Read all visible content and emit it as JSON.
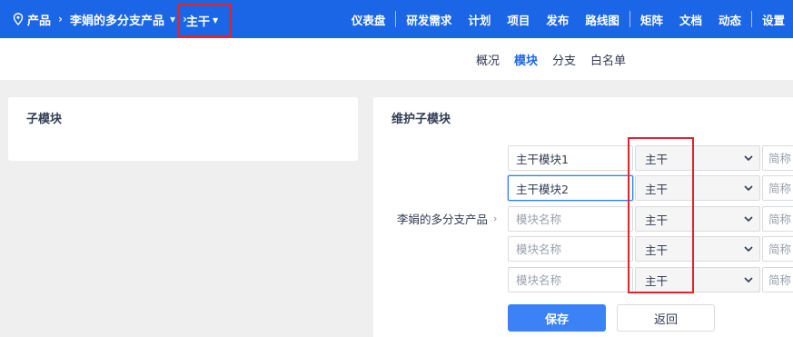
{
  "header": {
    "breadcrumb": {
      "product_label": "产品",
      "product_name": "李娟的多分支产品",
      "branch": "主干"
    },
    "nav": [
      "仪表盘",
      "研发需求",
      "计划",
      "项目",
      "发布",
      "路线图",
      "矩阵",
      "文档",
      "动态",
      "设置"
    ]
  },
  "tabs": [
    {
      "label": "概况",
      "active": false
    },
    {
      "label": "模块",
      "active": true
    },
    {
      "label": "分支",
      "active": false
    },
    {
      "label": "白名单",
      "active": false
    }
  ],
  "left_panel": {
    "title": "子模块"
  },
  "right_panel": {
    "title": "维护子模块",
    "product": "李娟的多分支产品",
    "rows": [
      {
        "name": "主干模块1",
        "name_placeholder": "模块名称",
        "branch": "主干",
        "abbr_placeholder": "简称"
      },
      {
        "name": "主干模块2",
        "name_placeholder": "模块名称",
        "branch": "主干",
        "abbr_placeholder": "简称"
      },
      {
        "name": "",
        "name_placeholder": "模块名称",
        "branch": "主干",
        "abbr_placeholder": "简称"
      },
      {
        "name": "",
        "name_placeholder": "模块名称",
        "branch": "主干",
        "abbr_placeholder": "简称"
      },
      {
        "name": "",
        "name_placeholder": "模块名称",
        "branch": "主干",
        "abbr_placeholder": "简称"
      }
    ],
    "save_label": "保存",
    "back_label": "返回"
  },
  "colors": {
    "primary": "#1a66e6",
    "button": "#3b82f6",
    "highlight": "#e0242c"
  }
}
